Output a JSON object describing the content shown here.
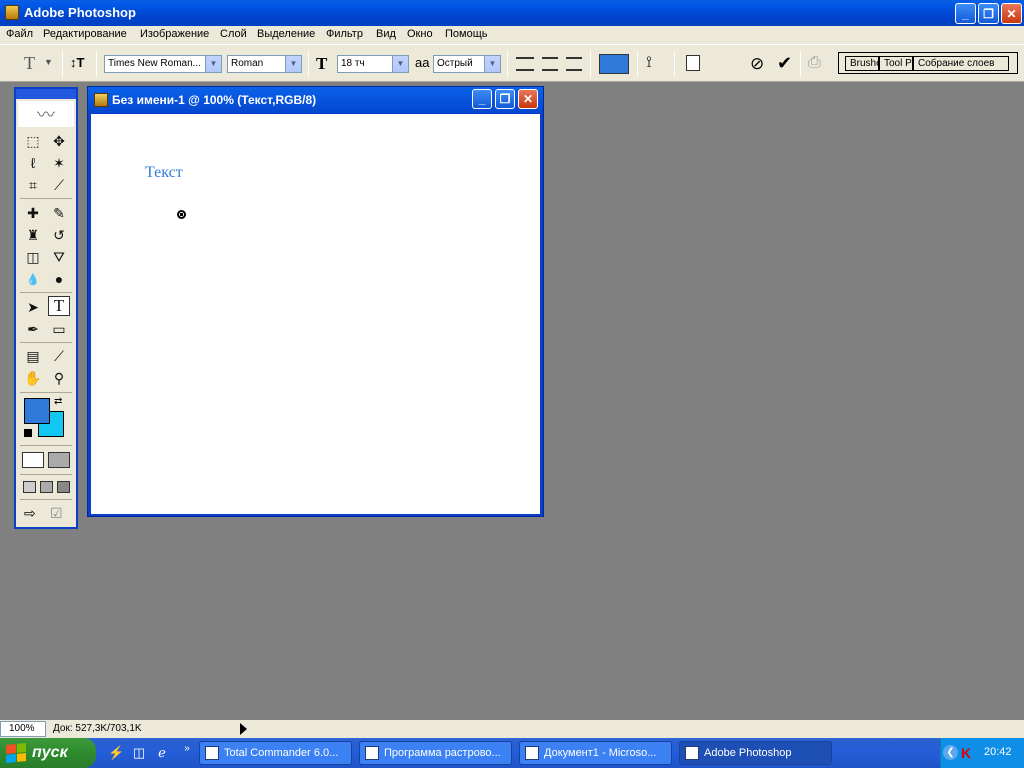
{
  "app": {
    "title": "Adobe Photoshop",
    "window_buttons": {
      "minimize": "_",
      "maximize": "❐",
      "close": "✕"
    }
  },
  "menu": [
    "Файл",
    "Редактирование",
    "Изображение",
    "Слой",
    "Выделение",
    "Фильтр",
    "Вид",
    "Окно",
    "Помощь"
  ],
  "options": {
    "tool_glyph": "T",
    "orient_glyph": "↕T",
    "font_family": "Times New Roman...",
    "font_style": "Roman",
    "size_glyph": "T",
    "font_size": "18 тч",
    "aa_glyph": "aa",
    "antialias": "Острый",
    "color_swatch": "#2f7ad8",
    "palette_tabs": [
      "Brushes",
      "Tool Presets",
      "Собрание слоев"
    ]
  },
  "toolbox": {
    "tools": [
      {
        "name": "marquee",
        "glyph": "⬚"
      },
      {
        "name": "move",
        "glyph": "✥"
      },
      {
        "name": "lasso",
        "glyph": "ℓ"
      },
      {
        "name": "magic-wand",
        "glyph": "✶"
      },
      {
        "name": "crop",
        "glyph": "⌗"
      },
      {
        "name": "slice",
        "glyph": "⟋"
      },
      {
        "name": "healing",
        "glyph": "✚"
      },
      {
        "name": "brush",
        "glyph": "✎"
      },
      {
        "name": "stamp",
        "glyph": "♜"
      },
      {
        "name": "history-brush",
        "glyph": "↺"
      },
      {
        "name": "eraser",
        "glyph": "◫"
      },
      {
        "name": "bucket",
        "glyph": "⛛"
      },
      {
        "name": "blur",
        "glyph": "💧"
      },
      {
        "name": "dodge",
        "glyph": "●"
      },
      {
        "name": "path-select",
        "glyph": "➤"
      },
      {
        "name": "type",
        "glyph": "T"
      },
      {
        "name": "pen",
        "glyph": "✒"
      },
      {
        "name": "shape",
        "glyph": "▭"
      },
      {
        "name": "notes",
        "glyph": "▤"
      },
      {
        "name": "eyedropper",
        "glyph": "⟋"
      },
      {
        "name": "hand",
        "glyph": "✋"
      },
      {
        "name": "zoom",
        "glyph": "⚲"
      }
    ],
    "foreground_color": "#2f7ad8",
    "background_color": "#12c8f0"
  },
  "document": {
    "title": "Без имени-1 @ 100% (Текст,RGB/8)",
    "canvas_text": "Текст",
    "text_color": "#2f7ad8"
  },
  "status": {
    "zoom": "100%",
    "doc_info": "Док: 527,3K/703,1K"
  },
  "taskbar": {
    "start_label": "пуск",
    "tasks": [
      {
        "label": "Total Commander 6.0..."
      },
      {
        "label": "Программа растрово..."
      },
      {
        "label": "Документ1 - Microso..."
      },
      {
        "label": "Adobe Photoshop"
      }
    ],
    "clock": "20:42"
  }
}
